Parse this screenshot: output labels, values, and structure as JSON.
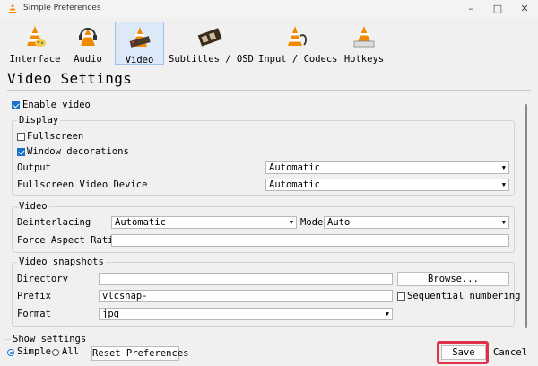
{
  "window": {
    "title": "Simple Preferences"
  },
  "toolbar": {
    "items": [
      {
        "label": "Interface",
        "icon": "cone-palette-icon"
      },
      {
        "label": "Audio",
        "icon": "cone-headphones-icon"
      },
      {
        "label": "Video",
        "icon": "cone-film-icon",
        "active": true
      },
      {
        "label": "Subtitles / OSD",
        "icon": "film-strip-icon"
      },
      {
        "label": "Input / Codecs",
        "icon": "cone-cable-icon"
      },
      {
        "label": "Hotkeys",
        "icon": "cone-keyboard-icon"
      }
    ]
  },
  "page": {
    "title": "Video Settings"
  },
  "enable_video": {
    "label": "Enable video",
    "checked": true
  },
  "display": {
    "title": "Display",
    "fullscreen": {
      "label": "Fullscreen",
      "checked": false
    },
    "window_decorations": {
      "label": "Window decorations",
      "checked": true
    },
    "output": {
      "label": "Output",
      "value": "Automatic"
    },
    "fullscreen_device": {
      "label": "Fullscreen Video Device",
      "value": "Automatic"
    }
  },
  "video": {
    "title": "Video",
    "deinterlacing": {
      "label": "Deinterlacing",
      "value": "Automatic"
    },
    "mode": {
      "label": "Mode",
      "value": "Auto"
    },
    "force_aspect": {
      "label": "Force Aspect Ratio",
      "value": ""
    }
  },
  "snapshots": {
    "title": "Video snapshots",
    "directory": {
      "label": "Directory",
      "value": ""
    },
    "browse_label": "Browse...",
    "prefix": {
      "label": "Prefix",
      "value": "vlcsnap-"
    },
    "sequential": {
      "label": "Sequential numbering",
      "checked": false
    },
    "format": {
      "label": "Format",
      "value": "jpg"
    }
  },
  "footer": {
    "show_settings": "Show settings",
    "simple": "Simple",
    "all": "All",
    "reset": "Reset Preferences",
    "save": "Save",
    "cancel": "Cancel"
  },
  "colors": {
    "accent": "#1a73c9",
    "highlight": "#e0334b",
    "active_tab": "#dbe9f8"
  }
}
